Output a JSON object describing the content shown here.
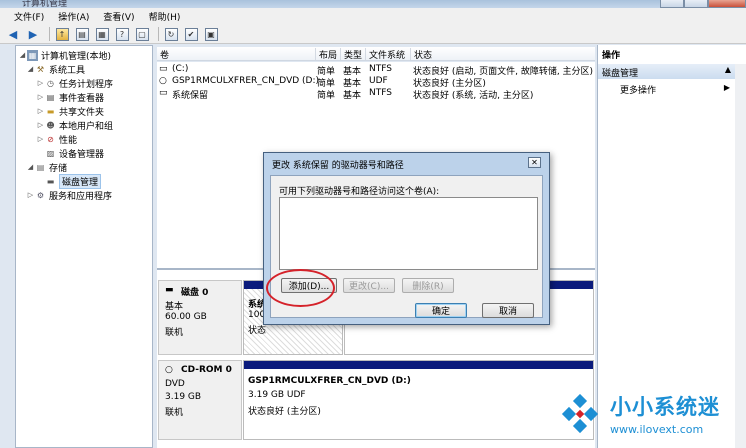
{
  "window": {
    "title": "计算机管理"
  },
  "menu": [
    "文件(F)",
    "操作(A)",
    "查看(V)",
    "帮助(H)"
  ],
  "tree": {
    "root": "计算机管理(本地)",
    "system_tools": "系统工具",
    "task_scheduler": "任务计划程序",
    "event_viewer": "事件查看器",
    "shared_folders": "共享文件夹",
    "local_users": "本地用户和组",
    "performance": "性能",
    "device_manager": "设备管理器",
    "storage": "存储",
    "disk_management": "磁盘管理",
    "services": "服务和应用程序"
  },
  "volumes": {
    "headers": [
      "卷",
      "布局",
      "类型",
      "文件系统",
      "状态"
    ],
    "rows": [
      {
        "name": "(C:)",
        "layout": "简单",
        "type": "基本",
        "fs": "NTFS",
        "status": "状态良好 (启动, 页面文件, 故障转储, 主分区)"
      },
      {
        "name": "GSP1RMCULXFRER_CN_DVD (D:)",
        "layout": "简单",
        "type": "基本",
        "fs": "UDF",
        "status": "状态良好 (主分区)"
      },
      {
        "name": "系统保留",
        "layout": "简单",
        "type": "基本",
        "fs": "NTFS",
        "status": "状态良好 (系统, 活动, 主分区)"
      }
    ]
  },
  "disks": {
    "disk0": {
      "name": "磁盘 0",
      "type": "基本",
      "size": "60.00 GB",
      "state": "联机",
      "part_name": "系统",
      "part_size": "100",
      "part_status": "状态"
    },
    "cdrom0": {
      "name": "CD-ROM 0",
      "type": "DVD",
      "size": "3.19 GB",
      "state": "联机",
      "part_name": "GSP1RMCULXFRER_CN_DVD  (D:)",
      "part_size": "3.19 GB UDF",
      "part_status": "状态良好 (主分区)"
    }
  },
  "actions": {
    "title": "操作",
    "section": "磁盘管理",
    "more": "更多操作"
  },
  "dialog": {
    "title": "更改 系统保留 的驱动器号和路径",
    "description": "可用下列驱动器号和路径访问这个卷(A):",
    "add": "添加(D)...",
    "change": "更改(C)...",
    "delete": "删除(R)",
    "ok": "确定",
    "cancel": "取消"
  },
  "watermark": {
    "name": "小小系统迷",
    "url": "www.ilovext.com"
  },
  "colors": {
    "accent": "#1d8fd4",
    "highlight": "#d5222a",
    "partition_bar": "#0b1b7c"
  }
}
